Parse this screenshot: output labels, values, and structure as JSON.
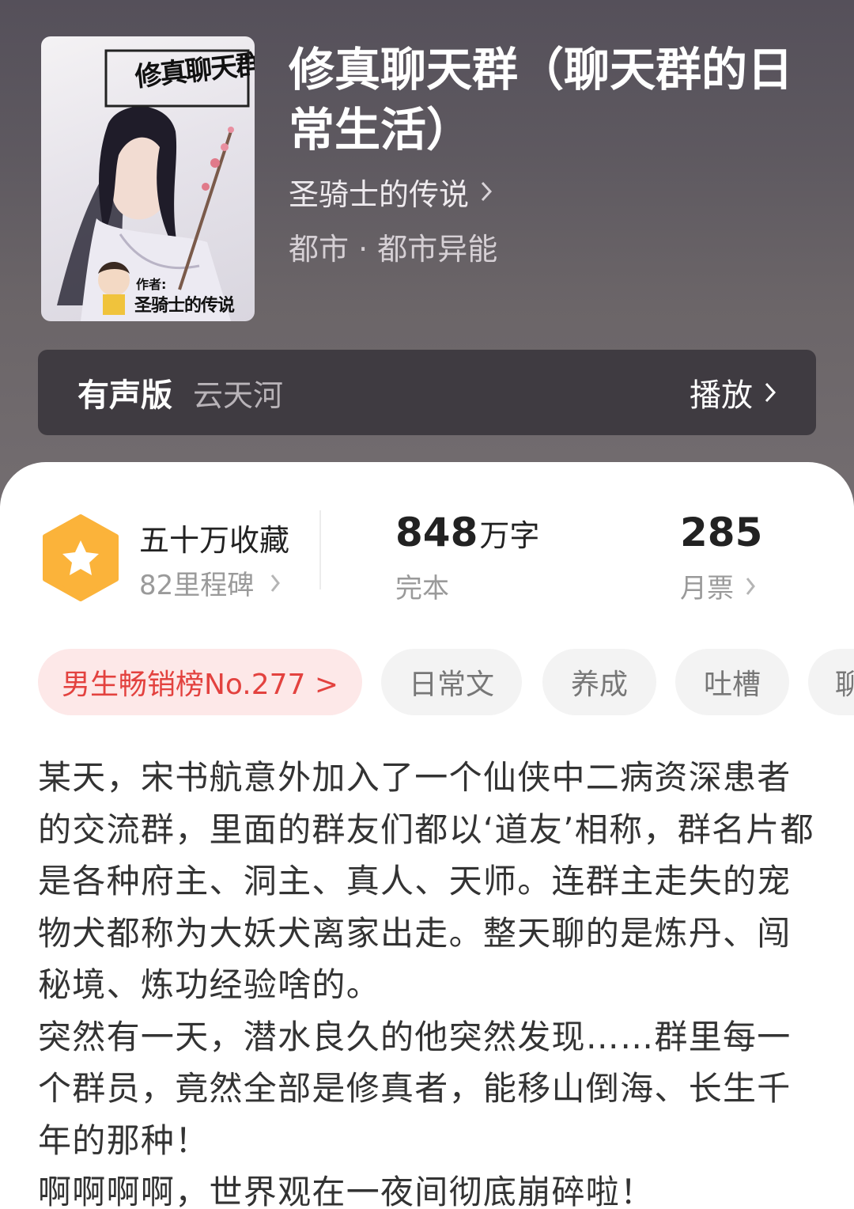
{
  "book": {
    "title": "修真聊天群（聊天群的日常生活）",
    "author": "圣骑士的传说",
    "genre": "都市 · 都市异能"
  },
  "cover": {
    "title_art": "修真聊天群",
    "author_label": "作者:",
    "author_name": "圣骑士的传说"
  },
  "audio": {
    "label": "有声版",
    "narrator": "云天河",
    "play_label": "播放"
  },
  "stats": {
    "collect_title": "五十万收藏",
    "milestone": "82里程碑",
    "word_count": "848",
    "word_unit": "万字",
    "status": "完本",
    "monthly_votes": "285",
    "votes_label": "月票"
  },
  "tags": [
    {
      "label": "男生畅销榜No.277 >"
    },
    {
      "label": "日常文"
    },
    {
      "label": "养成"
    },
    {
      "label": "吐槽"
    },
    {
      "label": "聊"
    }
  ],
  "synopsis": [
    "某天，宋书航意外加入了一个仙侠中二病资深患者的交流群，里面的群友们都以‘道友’相称，群名片都是各种府主、洞主、真人、天师。连群主走失的宠物犬都称为大妖犬离家出走。整天聊的是炼丹、闯秘境、炼功经验啥的。",
    "突然有一天，潜水良久的他突然发现……群里每一个群员，竟然全部是修真者，能移山倒海、长生千年的那种！",
    "啊啊啊啊，世界观在一夜间彻底崩碎啦！"
  ],
  "colors": {
    "header_bg": "#5e5960",
    "audio_bg": "#3f3b41",
    "badge_orange": "#fbb33a",
    "rank_tag_bg": "#fde8e8",
    "rank_tag_text": "#e3423f"
  }
}
